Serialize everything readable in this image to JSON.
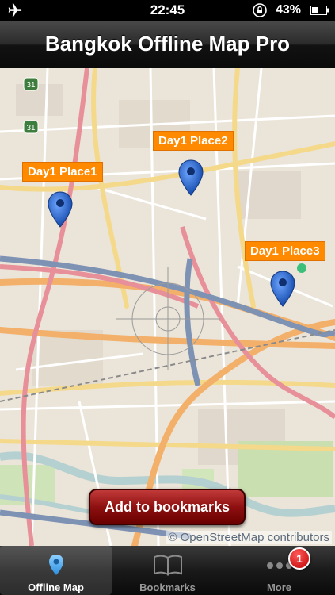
{
  "status_bar": {
    "time": "22:45",
    "battery": "43%"
  },
  "nav": {
    "title": "Bangkok Offline Map Pro"
  },
  "map": {
    "places": [
      "Day1 Place1",
      "Day1 Place2",
      "Day1 Place3"
    ],
    "credit": "© OpenStreetMap contributors",
    "road_shields": [
      "31",
      "31"
    ]
  },
  "actions": {
    "add_bookmark": "Add to bookmarks"
  },
  "tabs": [
    {
      "label": "Offline Map",
      "icon": "map-pin-icon"
    },
    {
      "label": "Bookmarks",
      "icon": "book-icon"
    },
    {
      "label": "More",
      "icon": "more-dots-icon"
    }
  ],
  "badge": {
    "count": "1"
  },
  "colors": {
    "label_bg": "#ff8a00",
    "button_bg": "#8e1010",
    "pin": "#2a6fd6"
  }
}
